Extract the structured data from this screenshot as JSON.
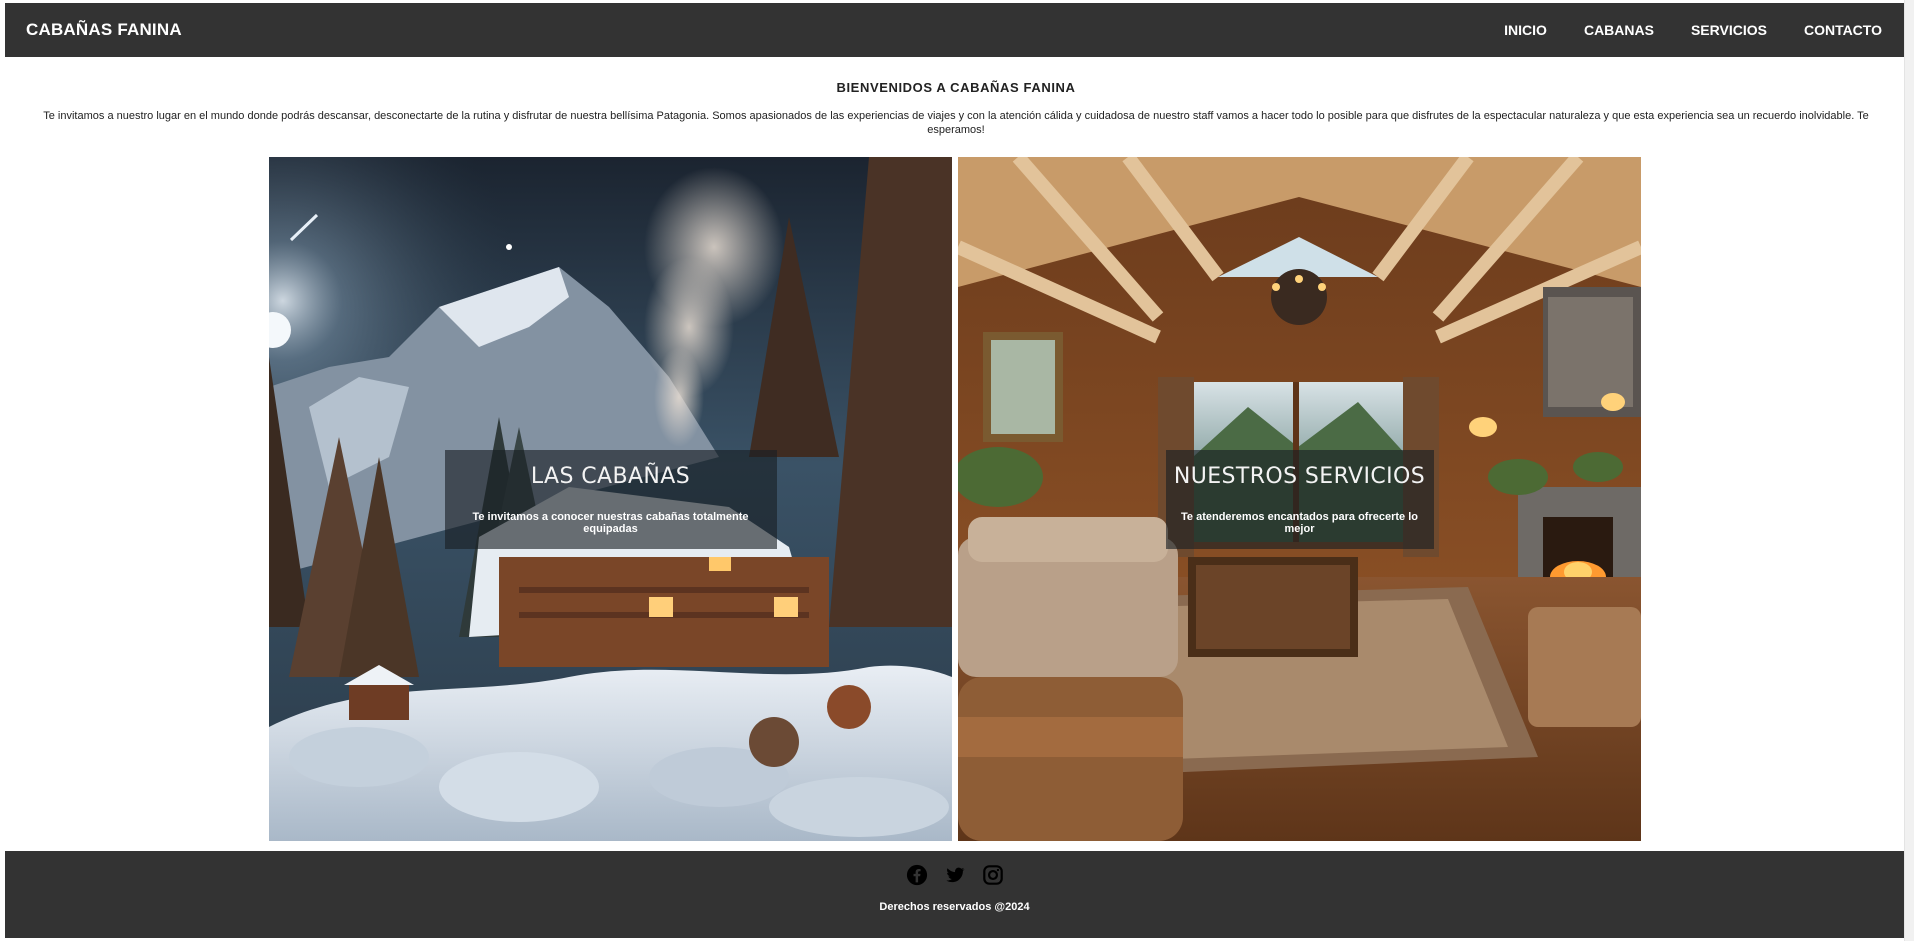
{
  "navbar": {
    "brand": "CABAÑAS FANINA",
    "links": [
      "INICIO",
      "CABANAS",
      "SERVICIOS",
      "CONTACTO"
    ]
  },
  "intro": {
    "title": "BIENVENIDOS A CABAÑAS FANINA",
    "text": "Te invitamos a nuestro lugar en el mundo donde podrás descansar, desconectarte de la rutina y disfrutar de nuestra bellísima Patagonia. Somos apasionados de las experiencias de viajes y con la atención cálida y cuidadosa de nuestro staff vamos a hacer todo lo posible para que disfrutes de la espectacular naturaleza y que esta experiencia sea un recuerdo inolvidable. Te esperamos!"
  },
  "cards": [
    {
      "title": "LAS CABAÑAS",
      "subtitle": "Te invitamos a conocer nuestras cabañas totalmente equipadas",
      "image": "snowy-cabin-night-photo"
    },
    {
      "title": "NUESTROS SERVICIOS",
      "subtitle": "Te atenderemos encantados para ofrecerte lo mejor",
      "image": "log-cabin-living-room-photo"
    }
  ],
  "footer": {
    "social_icons": [
      "facebook-icon",
      "twitter-icon",
      "instagram-icon"
    ],
    "copyright": "Derechos reservados @2024"
  },
  "colors": {
    "navbar_bg": "#333333",
    "footer_bg": "#333333",
    "text_light": "#ffffff"
  }
}
